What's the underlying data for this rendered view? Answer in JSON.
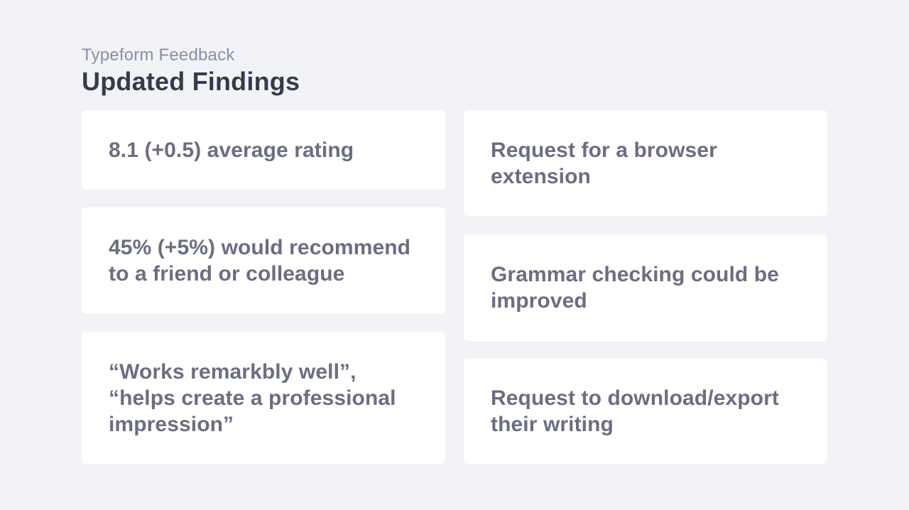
{
  "header": {
    "eyebrow": "Typeform Feedback",
    "title": "Updated Findings"
  },
  "findings": {
    "left": [
      "8.1 (+0.5) average rating",
      "45% (+5%) would recommend to a friend or colleague",
      "“Works remarkbly well”, “helps create a professional impression”"
    ],
    "right": [
      "Request for a browser extension",
      "Grammar checking could be improved",
      "Request to download/export their writing"
    ]
  },
  "colors": {
    "background": "#f2f3f7",
    "card": "#ffffff",
    "title": "#373a4a",
    "eyebrow": "#8b8fa3",
    "card_text": "#6b6e82"
  }
}
